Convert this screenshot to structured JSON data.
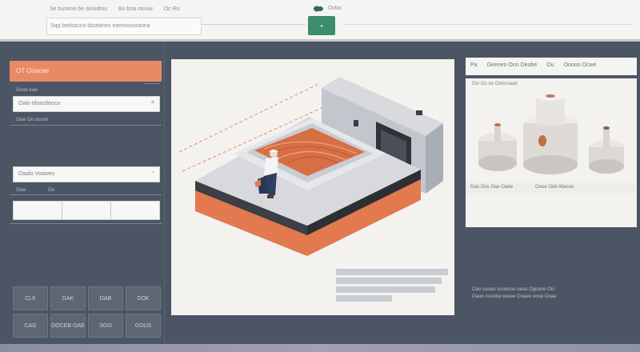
{
  "topbar": {
    "tabs": [
      "Se bunime be aloodmu",
      "Bo boa mouw",
      "Oc Ro"
    ],
    "address_value": "Sqq bedsacco bbotaneo eamooooraona",
    "go_label": "▪",
    "right_label": "Ovbo"
  },
  "left_panel": {
    "header_label": "OT  Ooacee",
    "label_1": "Ooob eaw",
    "field_1_value": "Oalo Idooclleoca",
    "label_2": "Oow Oo oooon",
    "field_2_value": "Oaalo Voaweo",
    "label_3a": "Oow",
    "label_3b": "Oo",
    "keypad": [
      "CLK",
      "DAK",
      "DAB",
      "DOK",
      "CAG",
      "DOCEB OAE",
      "SGO",
      "GOUS"
    ]
  },
  "right_panel": {
    "header_items": [
      "Pa",
      "Geeneo Onn Deobe",
      "Ou",
      "Ooooo Ocwe"
    ],
    "thumb_caption": "Dio Oo oo Odonoaad",
    "bar_left": "Dao Oos Oae Oade",
    "bar_right": "Oooe Oeb Waooe",
    "text_lines": [
      "Oao oaoao ocoanoo oaoa Ogoane Olo",
      "Oaue oceoba oaoee Ooaee ooue Ooae"
    ]
  },
  "colors": {
    "accent_orange": "#e98a67",
    "panel_bg": "#4b5563",
    "go_green": "#3c8c6e",
    "canvas_bg": "#f3f2ef"
  }
}
